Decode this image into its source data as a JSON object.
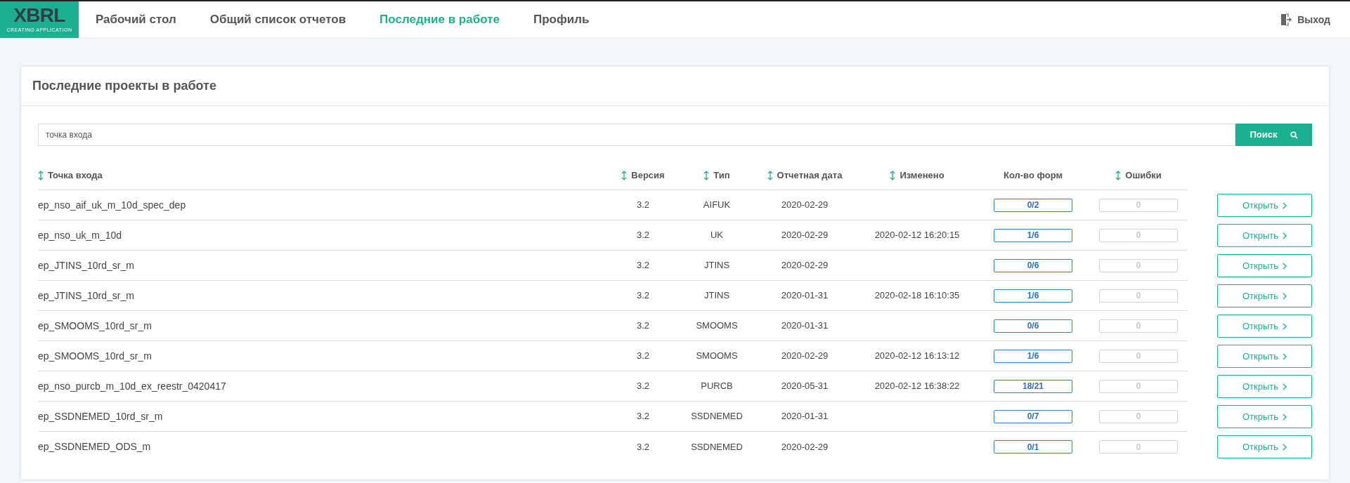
{
  "logo": {
    "title": "XBRL",
    "subtitle": "CREATING APPLICATION"
  },
  "nav": [
    {
      "label": "Рабочий стол",
      "selected": false
    },
    {
      "label": "Общий список отчетов",
      "selected": false
    },
    {
      "label": "Последние в работе",
      "selected": true
    },
    {
      "label": "Профиль",
      "selected": false
    }
  ],
  "logout": {
    "label": "Выход"
  },
  "card": {
    "title": "Последние проекты в работе"
  },
  "search": {
    "value": "точка входа",
    "button": "Поиск"
  },
  "table": {
    "columns": [
      {
        "label": "Точка входа",
        "sortable": true
      },
      {
        "label": "Версия",
        "sortable": true
      },
      {
        "label": "Тип",
        "sortable": true
      },
      {
        "label": "Отчетная дата",
        "sortable": true
      },
      {
        "label": "Изменено",
        "sortable": true
      },
      {
        "label": "Кол-во форм",
        "sortable": false
      },
      {
        "label": "Ошибки",
        "sortable": true
      }
    ],
    "rows": [
      {
        "entry": "ep_nso_aif_uk_m_10d_spec_dep",
        "version": "3.2",
        "type": "AIFUK",
        "date": "2020-02-29",
        "changed": "",
        "forms": "0/2",
        "errors": "0",
        "action": "Открыть"
      },
      {
        "entry": "ep_nso_uk_m_10d",
        "version": "3.2",
        "type": "UK",
        "date": "2020-02-29",
        "changed": "2020-02-12 16:20:15",
        "forms": "1/6",
        "errors": "0",
        "action": "Открыть"
      },
      {
        "entry": "ep_JTINS_10rd_sr_m",
        "version": "3.2",
        "type": "JTINS",
        "date": "2020-02-29",
        "changed": "",
        "forms": "0/6",
        "errors": "0",
        "action": "Открыть"
      },
      {
        "entry": "ep_JTINS_10rd_sr_m",
        "version": "3.2",
        "type": "JTINS",
        "date": "2020-01-31",
        "changed": "2020-02-18 16:10:35",
        "forms": "1/6",
        "errors": "0",
        "action": "Открыть"
      },
      {
        "entry": "ep_SMOOMS_10rd_sr_m",
        "version": "3.2",
        "type": "SMOOMS",
        "date": "2020-01-31",
        "changed": "",
        "forms": "0/6",
        "errors": "0",
        "action": "Открыть"
      },
      {
        "entry": "ep_SMOOMS_10rd_sr_m",
        "version": "3.2",
        "type": "SMOOMS",
        "date": "2020-02-29",
        "changed": "2020-02-12 16:13:12",
        "forms": "1/6",
        "errors": "0",
        "action": "Открыть"
      },
      {
        "entry": "ep_nso_purcb_m_10d_ex_reestr_0420417",
        "version": "3.2",
        "type": "PURCB",
        "date": "2020-05-31",
        "changed": "2020-02-12 16:38:22",
        "forms": "18/21",
        "errors": "0",
        "action": "Открыть"
      },
      {
        "entry": "ep_SSDNEMED_10rd_sr_m",
        "version": "3.2",
        "type": "SSDNEMED",
        "date": "2020-01-31",
        "changed": "",
        "forms": "0/7",
        "errors": "0",
        "action": "Открыть"
      },
      {
        "entry": "ep_SSDNEMED_ODS_m",
        "version": "3.2",
        "type": "SSDNEMED",
        "date": "2020-02-29",
        "changed": "",
        "forms": "0/1",
        "errors": "0",
        "action": "Открыть"
      }
    ]
  }
}
